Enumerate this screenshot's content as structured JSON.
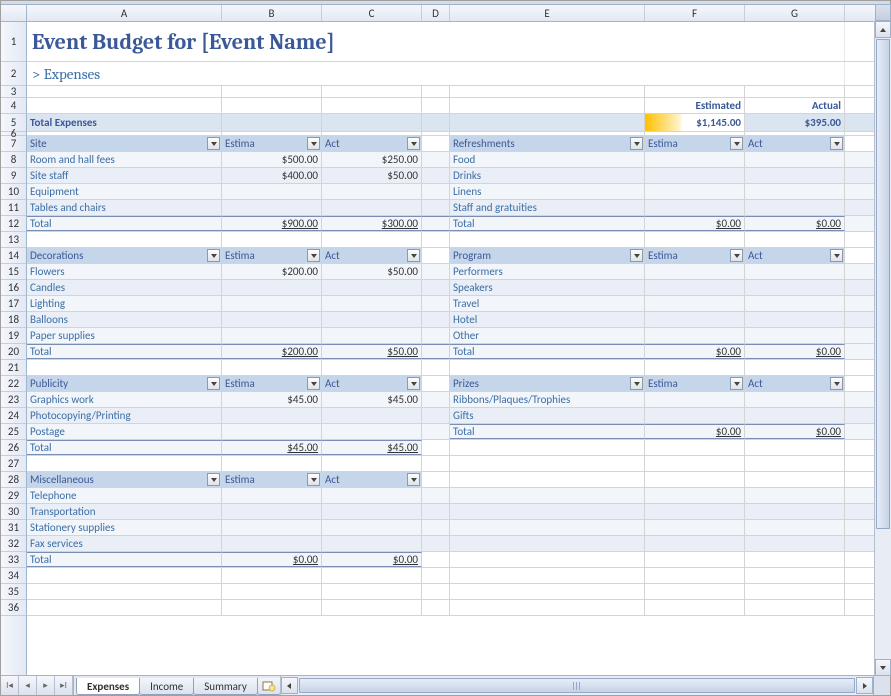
{
  "columns": [
    "A",
    "B",
    "C",
    "D",
    "E",
    "F",
    "G"
  ],
  "title": "Event Budget for [Event Name]",
  "subtitle": "> Expenses",
  "headers": {
    "estimated": "Estimated",
    "actual": "Actual"
  },
  "totals": {
    "label": "Total Expenses",
    "estimated": "$1,145.00",
    "actual": "$395.00"
  },
  "colhdr": {
    "estimated": "Estima",
    "actual": "Act"
  },
  "left": [
    {
      "name": "Site",
      "rows": [
        {
          "label": "Room and hall fees",
          "est": "$500.00",
          "act": "$250.00"
        },
        {
          "label": "Site staff",
          "est": "$400.00",
          "act": "$50.00"
        },
        {
          "label": "Equipment",
          "est": "",
          "act": ""
        },
        {
          "label": "Tables and chairs",
          "est": "",
          "act": ""
        }
      ],
      "total": {
        "label": "Total",
        "est": "$900.00",
        "act": "$300.00"
      }
    },
    {
      "name": "Decorations",
      "rows": [
        {
          "label": "Flowers",
          "est": "$200.00",
          "act": "$50.00"
        },
        {
          "label": "Candles",
          "est": "",
          "act": ""
        },
        {
          "label": "Lighting",
          "est": "",
          "act": ""
        },
        {
          "label": "Balloons",
          "est": "",
          "act": ""
        },
        {
          "label": "Paper supplies",
          "est": "",
          "act": ""
        }
      ],
      "total": {
        "label": "Total",
        "est": "$200.00",
        "act": "$50.00"
      }
    },
    {
      "name": "Publicity",
      "rows": [
        {
          "label": "Graphics work",
          "est": "$45.00",
          "act": "$45.00"
        },
        {
          "label": "Photocopying/Printing",
          "est": "",
          "act": ""
        },
        {
          "label": "Postage",
          "est": "",
          "act": ""
        }
      ],
      "total": {
        "label": "Total",
        "est": "$45.00",
        "act": "$45.00"
      }
    },
    {
      "name": "Miscellaneous",
      "rows": [
        {
          "label": "Telephone",
          "est": "",
          "act": ""
        },
        {
          "label": "Transportation",
          "est": "",
          "act": ""
        },
        {
          "label": "Stationery supplies",
          "est": "",
          "act": ""
        },
        {
          "label": "Fax services",
          "est": "",
          "act": ""
        }
      ],
      "total": {
        "label": "Total",
        "est": "$0.00",
        "act": "$0.00"
      }
    }
  ],
  "right": [
    {
      "name": "Refreshments",
      "rows": [
        {
          "label": "Food",
          "est": "",
          "act": ""
        },
        {
          "label": "Drinks",
          "est": "",
          "act": ""
        },
        {
          "label": "Linens",
          "est": "",
          "act": ""
        },
        {
          "label": "Staff and gratuities",
          "est": "",
          "act": ""
        }
      ],
      "total": {
        "label": "Total",
        "est": "$0.00",
        "act": "$0.00"
      }
    },
    {
      "name": "Program",
      "rows": [
        {
          "label": "Performers",
          "est": "",
          "act": ""
        },
        {
          "label": "Speakers",
          "est": "",
          "act": ""
        },
        {
          "label": "Travel",
          "est": "",
          "act": ""
        },
        {
          "label": "Hotel",
          "est": "",
          "act": ""
        },
        {
          "label": "Other",
          "est": "",
          "act": ""
        }
      ],
      "total": {
        "label": "Total",
        "est": "$0.00",
        "act": "$0.00"
      }
    },
    {
      "name": "Prizes",
      "rows": [
        {
          "label": "Ribbons/Plaques/Trophies",
          "est": "",
          "act": ""
        },
        {
          "label": "Gifts",
          "est": "",
          "act": ""
        }
      ],
      "total": {
        "label": "Total",
        "est": "$0.00",
        "act": "$0.00"
      }
    }
  ],
  "tabs": {
    "active": "Expenses",
    "others": [
      "Income",
      "Summary"
    ]
  }
}
